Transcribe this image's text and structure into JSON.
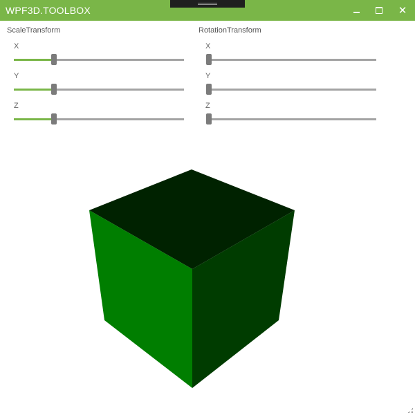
{
  "window": {
    "title": "WPF3D.TOOLBOX",
    "accent": "#7ab648",
    "controls": {
      "minimize_icon": "minimize-icon",
      "maximize_icon": "maximize-icon",
      "close_glyph": "✕"
    }
  },
  "scale_transform": {
    "label": "ScaleTransform",
    "sliders": [
      {
        "axis": "X",
        "value": 0.225
      },
      {
        "axis": "Y",
        "value": 0.225
      },
      {
        "axis": "Z",
        "value": 0.225
      }
    ]
  },
  "rotation_transform": {
    "label": "RotationTransform",
    "sliders": [
      {
        "axis": "X",
        "value": 0.0
      },
      {
        "axis": "Y",
        "value": 0.0
      },
      {
        "axis": "Z",
        "value": 0.0
      }
    ]
  },
  "viewport": {
    "cube_colors": {
      "top": "#002200",
      "left": "#007e00",
      "right": "#003c00"
    }
  }
}
